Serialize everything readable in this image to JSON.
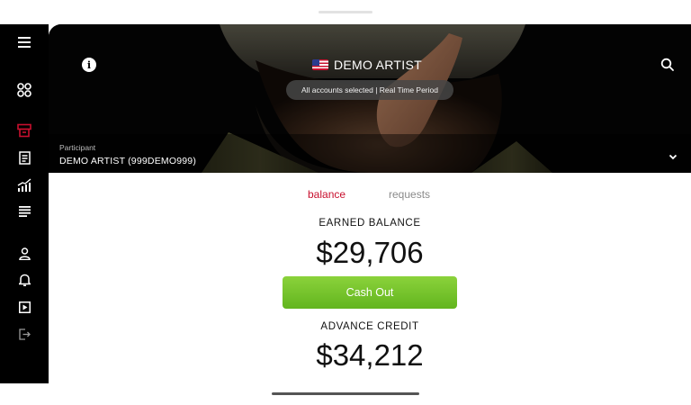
{
  "header": {
    "title": "DEMO ARTIST",
    "flag_icon": "us-flag-icon",
    "accounts_filter": "All accounts selected | Real Time Period",
    "info_icon": "info-icon",
    "search_icon": "search-icon"
  },
  "participant": {
    "label": "Participant",
    "value": "DEMO ARTIST (999DEMO999)",
    "chevron_icon": "chevron-down-icon"
  },
  "sidebar": {
    "items": [
      {
        "icon": "hamburger-menu-icon"
      },
      {
        "icon": "dashboard-grid-icon"
      },
      {
        "icon": "cash-register-icon",
        "active": true,
        "color": "#c8102e"
      },
      {
        "icon": "statement-document-icon"
      },
      {
        "icon": "analytics-trend-icon"
      },
      {
        "icon": "list-lines-icon"
      },
      {
        "icon": "profile-icon"
      },
      {
        "icon": "notification-bell-icon"
      },
      {
        "icon": "video-play-icon"
      },
      {
        "icon": "logout-icon"
      }
    ]
  },
  "tabs": [
    {
      "label": "balance",
      "active": true
    },
    {
      "label": "requests",
      "active": false
    }
  ],
  "balance": {
    "earned_label": "EARNED BALANCE",
    "earned_amount": "$29,706",
    "cashout_label": "Cash Out",
    "advance_label": "ADVANCE CREDIT",
    "advance_amount": "$34,212"
  },
  "colors": {
    "accent": "#c8102e",
    "cashout_green": "#6fc026",
    "sidebar_bg": "#000000"
  }
}
